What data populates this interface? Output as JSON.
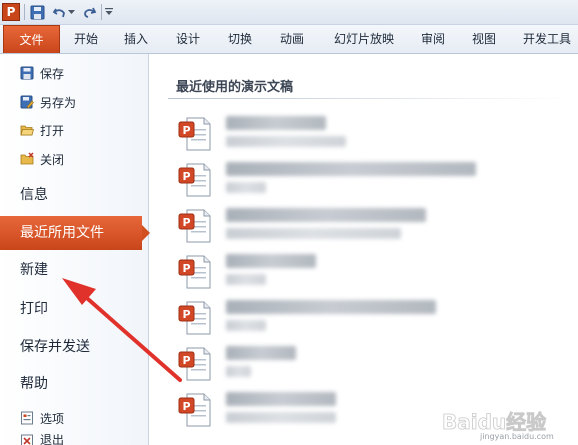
{
  "app": {
    "logo_letter": "P",
    "accent": "#c9461a"
  },
  "qat": {
    "icons": [
      "save-icon",
      "undo-icon",
      "undo-dropdown-icon",
      "redo-icon",
      "customize-icon"
    ]
  },
  "tabs": [
    {
      "label": "文件",
      "active": true
    },
    {
      "label": "开始"
    },
    {
      "label": "插入"
    },
    {
      "label": "设计"
    },
    {
      "label": "切换"
    },
    {
      "label": "动画"
    },
    {
      "label": "幻灯片放映"
    },
    {
      "label": "审阅"
    },
    {
      "label": "视图"
    },
    {
      "label": "开发工具"
    }
  ],
  "nav": {
    "save": "保存",
    "save_as": "另存为",
    "open": "打开",
    "close": "关闭",
    "info": "信息",
    "recent": "最近所用文件",
    "new": "新建",
    "print": "打印",
    "save_send": "保存并发送",
    "help": "帮助",
    "options": "选项",
    "exit": "退出"
  },
  "content": {
    "title": "最近使用的演示文稿",
    "recent_docs": [
      {
        "name": "■■■■■■■■■■■■■■",
        "path": "■■■■■■■■■■■■■"
      },
      {
        "name": "■■■■■■■■■■■■■■■■■■■■■■■■■■■■■■■■",
        "path": "■■■■■"
      },
      {
        "name": "■■■■■■■■■■■■■■■■■■■■■■■■■■■■■■■■■",
        "path": "■■■■■■■■■■■■■■■■■■■■■■■■■■"
      },
      {
        "name": "■■■■■■■■■■■■■■■",
        "path": "■■■■■"
      },
      {
        "name": "■■■■■■■■■■■■■■■■■■■■■■■■■■■■",
        "path": "■■■■■"
      },
      {
        "name": "■■■■■■■■■■■■",
        "path": "■■■"
      },
      {
        "name": "■■■■■■■■■■■■■■■■■",
        "path": "■■■■■■■■■■■■■■■"
      }
    ]
  },
  "watermark": {
    "text": "Baidu经验",
    "sub": "jingyan.baidu.com"
  }
}
